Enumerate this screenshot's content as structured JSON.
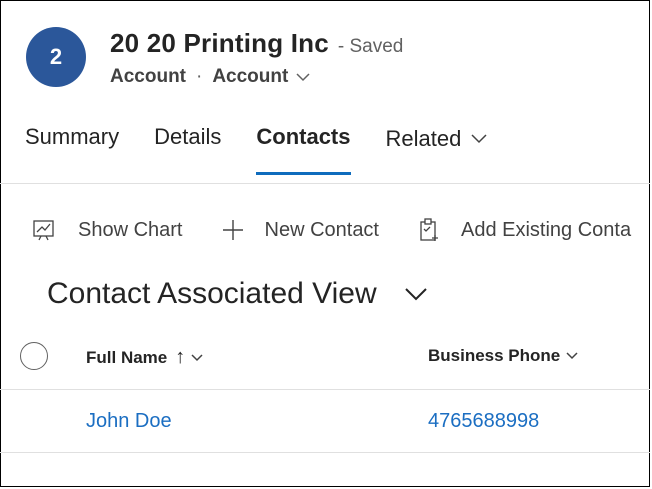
{
  "header": {
    "avatar_text": "2",
    "record_title": "20 20 Printing Inc",
    "save_status": "- Saved",
    "entity": "Account",
    "form_selector": "Account"
  },
  "tabs": [
    {
      "label": "Summary",
      "active": false
    },
    {
      "label": "Details",
      "active": false
    },
    {
      "label": "Contacts",
      "active": true
    },
    {
      "label": "Related",
      "active": false
    }
  ],
  "commands": {
    "show_chart": "Show Chart",
    "new_contact": "New Contact",
    "add_existing": "Add Existing Conta"
  },
  "view": {
    "title": "Contact Associated View"
  },
  "grid": {
    "columns": [
      "Full Name",
      "Business Phone"
    ],
    "sort_indicator": "↑",
    "rows": [
      {
        "full_name": "John Doe",
        "business_phone": "4765688998"
      }
    ]
  },
  "colors": {
    "avatar_bg": "#2b579a",
    "accent": "#0f6cbd",
    "link": "#1b6ec2"
  }
}
